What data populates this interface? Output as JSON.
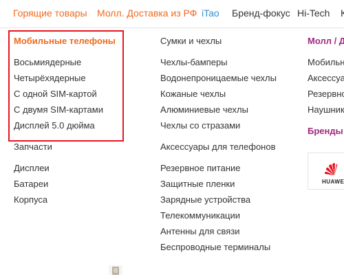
{
  "topnav": {
    "items": [
      {
        "label": "Горящие товары",
        "color": "#f06a1d"
      },
      {
        "label": "Молл. Доставка из РФ",
        "color": "#f06a1d"
      },
      {
        "label": "iTao",
        "color": "#2f8fd1"
      },
      {
        "label": "Бренд-фокус",
        "color": "#333333"
      },
      {
        "label": "Hi-Tech",
        "color": "#333333"
      },
      {
        "label": "К",
        "color": "#333333"
      }
    ]
  },
  "columns": {
    "col1": {
      "groups": [
        {
          "title": "Мобильные телефоны",
          "items": [
            "Восьмиядерные",
            "Четырёхядерные",
            "С одной SIM-картой",
            "С двумя SIM-картами",
            "Дисплей 5.0 дюйма"
          ]
        },
        {
          "title": "Запчасти",
          "items": [
            "Дисплеи",
            "Батареи",
            "Корпуса"
          ]
        }
      ]
    },
    "col2": {
      "groups": [
        {
          "title": "Сумки и чехлы",
          "items": [
            "Чехлы-бамперы",
            "Водонепроницаемые чехлы",
            "Кожаные чехлы",
            "Алюминиевые чехлы",
            "Чехлы со стразами"
          ]
        },
        {
          "title": "Аксессуары для телефонов",
          "items": [
            "Резервное питание",
            "Защитные пленки",
            "Зарядные устройства",
            "Телекоммуникации",
            "Антенны для связи",
            "Беспроводные терминалы"
          ]
        }
      ]
    },
    "col3": {
      "groups": [
        {
          "title": "Молл / Д",
          "items": [
            "Мобильн",
            "Аксессуа",
            "Резервно",
            "Наушник"
          ]
        },
        {
          "title": "Бренды /",
          "items": []
        }
      ]
    }
  },
  "brand_logo": {
    "name": "huawei-logo",
    "text": "HUAWEI",
    "color": "#e8141f"
  },
  "colors": {
    "accent": "#f06a1d",
    "highlight": "#e8141f",
    "purple": "#a0287f",
    "link_blue": "#2f8fd1"
  }
}
